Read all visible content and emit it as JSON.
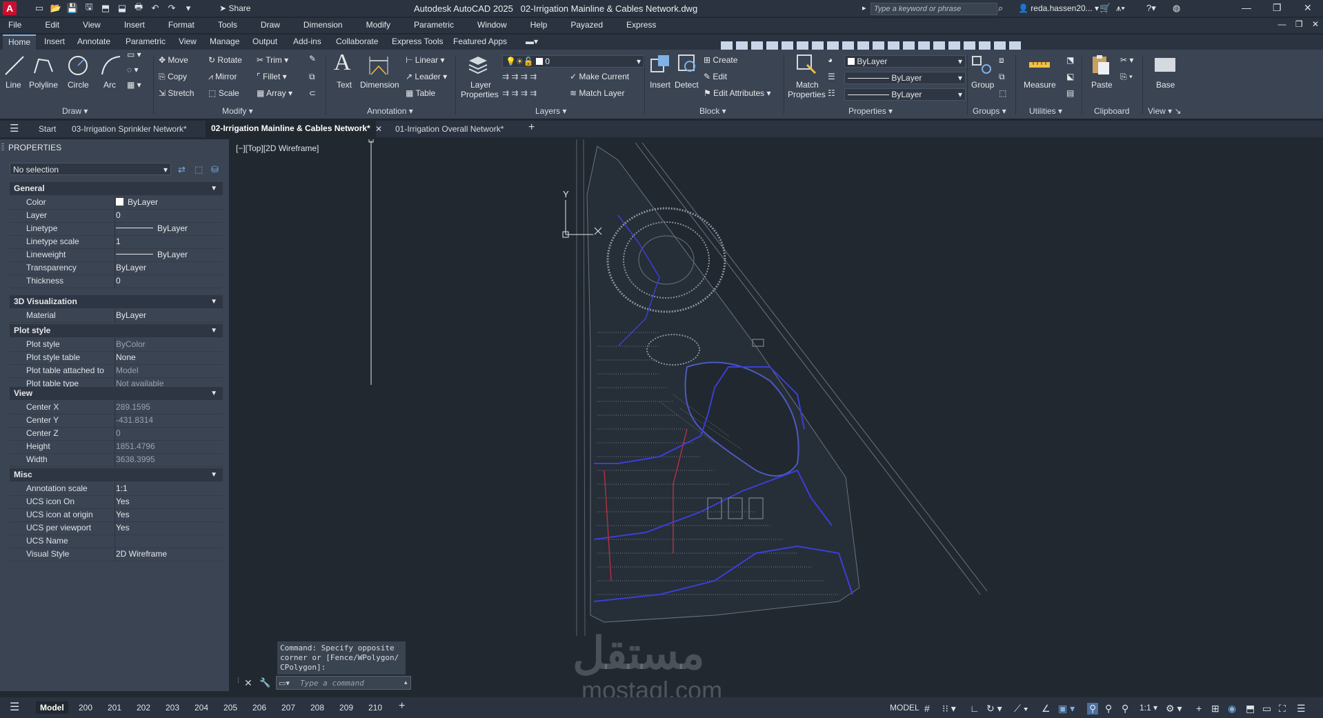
{
  "title": {
    "app": "Autodesk AutoCAD 2025",
    "file": "02-Irrigation Mainline & Cables Network.dwg",
    "share": "Share",
    "search_placeholder": "Type a keyword or phrase",
    "user": "reda.hassen20..."
  },
  "menu": [
    "File",
    "Edit",
    "View",
    "Insert",
    "Format",
    "Tools",
    "Draw",
    "Dimension",
    "Modify",
    "Parametric",
    "Window",
    "Help",
    "Payazed",
    "Express"
  ],
  "ribbon_tabs": [
    "Home",
    "Insert",
    "Annotate",
    "Parametric",
    "View",
    "Manage",
    "Output",
    "Add-ins",
    "Collaborate",
    "Express Tools",
    "Featured Apps"
  ],
  "ribbon": {
    "draw": {
      "line": "Line",
      "polyline": "Polyline",
      "circle": "Circle",
      "arc": "Arc",
      "label": "Draw"
    },
    "modify": {
      "move": "Move",
      "rotate": "Rotate",
      "trim": "Trim",
      "copy": "Copy",
      "mirror": "Mirror",
      "fillet": "Fillet",
      "stretch": "Stretch",
      "scale": "Scale",
      "array": "Array",
      "label": "Modify"
    },
    "annotation": {
      "text": "Text",
      "dimension": "Dimension",
      "linear": "Linear",
      "leader": "Leader",
      "table": "Table",
      "label": "Annotation"
    },
    "layers": {
      "layer_properties_1": "Layer",
      "layer_properties_2": "Properties",
      "current_layer": "0",
      "make_current": "Make Current",
      "match_layer": "Match Layer",
      "label": "Layers"
    },
    "block": {
      "insert": "Insert",
      "detect": "Detect",
      "create": "Create",
      "edit": "Edit",
      "edit_attributes": "Edit Attributes",
      "label": "Block"
    },
    "properties": {
      "match_1": "Match",
      "match_2": "Properties",
      "color": "ByLayer",
      "linetype": "ByLayer",
      "lineweight": "ByLayer",
      "label": "Properties"
    },
    "groups": {
      "group": "Group",
      "label": "Groups"
    },
    "utilities": {
      "measure": "Measure",
      "label": "Utilities"
    },
    "clipboard": {
      "paste": "Paste",
      "label": "Clipboard"
    },
    "view": {
      "base": "Base",
      "label": "View"
    }
  },
  "doc_tabs": {
    "start": "Start",
    "tab1": "03-Irrigation Sprinkler Network*",
    "tab2": "02-Irrigation Mainline & Cables Network*",
    "tab3": "01-Irrigation Overall Network*"
  },
  "properties_panel": {
    "title": "PROPERTIES",
    "selection": "No selection",
    "general": {
      "header": "General",
      "rows": [
        [
          "Color",
          "ByLayer"
        ],
        [
          "Layer",
          "0"
        ],
        [
          "Linetype",
          "ByLayer"
        ],
        [
          "Linetype scale",
          "1"
        ],
        [
          "Lineweight",
          "ByLayer"
        ],
        [
          "Transparency",
          "ByLayer"
        ],
        [
          "Thickness",
          "0"
        ]
      ]
    },
    "viz": {
      "header": "3D Visualization",
      "rows": [
        [
          "Material",
          "ByLayer"
        ]
      ]
    },
    "plot": {
      "header": "Plot style",
      "rows": [
        [
          "Plot style",
          "ByColor"
        ],
        [
          "Plot style table",
          "None"
        ],
        [
          "Plot table attached to",
          "Model"
        ],
        [
          "Plot table type",
          "Not available"
        ]
      ]
    },
    "view": {
      "header": "View",
      "rows": [
        [
          "Center X",
          "289.1595"
        ],
        [
          "Center Y",
          "-431.8314"
        ],
        [
          "Center Z",
          "0"
        ],
        [
          "Height",
          "1851.4796"
        ],
        [
          "Width",
          "3638.3995"
        ]
      ]
    },
    "misc": {
      "header": "Misc",
      "rows": [
        [
          "Annotation scale",
          "1:1"
        ],
        [
          "UCS icon On",
          "Yes"
        ],
        [
          "UCS icon at origin",
          "Yes"
        ],
        [
          "UCS per viewport",
          "Yes"
        ],
        [
          "UCS Name",
          ""
        ],
        [
          "Visual Style",
          "2D Wireframe"
        ]
      ]
    }
  },
  "viewport_label": "[−][Top][2D Wireframe]",
  "ucs": {
    "y": "Y",
    "x": "X"
  },
  "command": {
    "history_1": "Command: Specify opposite",
    "history_2": "corner or [Fence/WPolygon/",
    "history_3": "CPolygon]:",
    "placeholder": "Type a command"
  },
  "layouts": [
    "Model",
    "200",
    "201",
    "202",
    "203",
    "204",
    "205",
    "206",
    "207",
    "208",
    "209",
    "210"
  ],
  "status": {
    "model": "MODEL",
    "scale": "1:1"
  },
  "watermark": {
    "arabic": "مستقل",
    "latin": "mostaql.com"
  }
}
